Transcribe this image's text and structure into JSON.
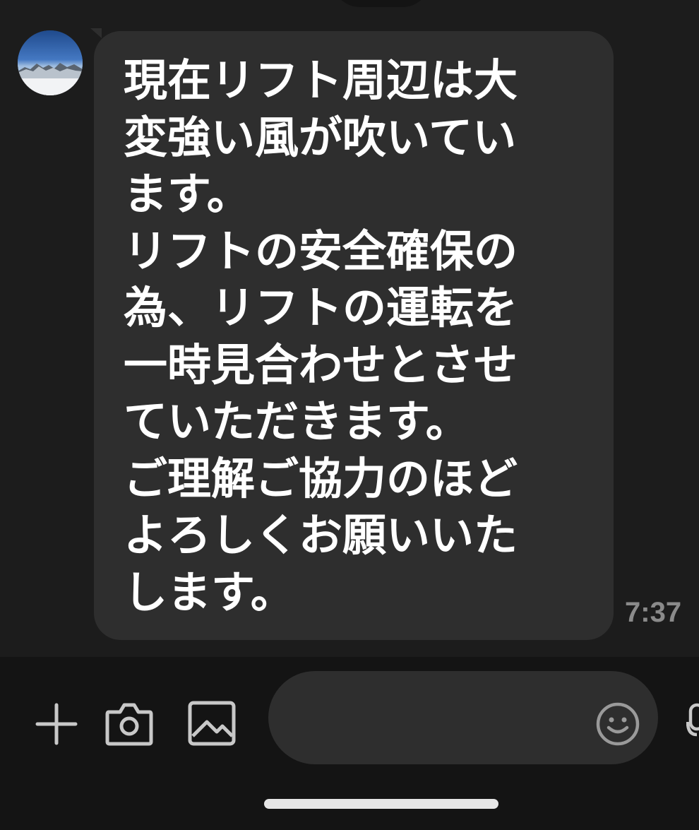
{
  "message": {
    "text": "現在リフト周辺は大\n変強い風が吹いてい\nます。\nリフトの安全確保の\n為、リフトの運転を\n一時見合わせとさせ\nていただきます。\nご理解ご協力のほど\nよろしくお願いいた\nします。",
    "time": "7:37"
  },
  "input": {
    "placeholder": "",
    "value": ""
  },
  "icons": {
    "avatar": "mountain-landscape-photo",
    "plus": "plus-icon",
    "camera": "camera-icon",
    "image": "image-icon",
    "emoji": "smiley-icon",
    "mic": "microphone-icon"
  },
  "colors": {
    "background": "#1c1c1c",
    "bubble": "#2e2e2e",
    "text": "#ffffff",
    "timestamp": "#8a8a8a",
    "input_bar": "#141414",
    "icon": "#c8c8c8"
  }
}
